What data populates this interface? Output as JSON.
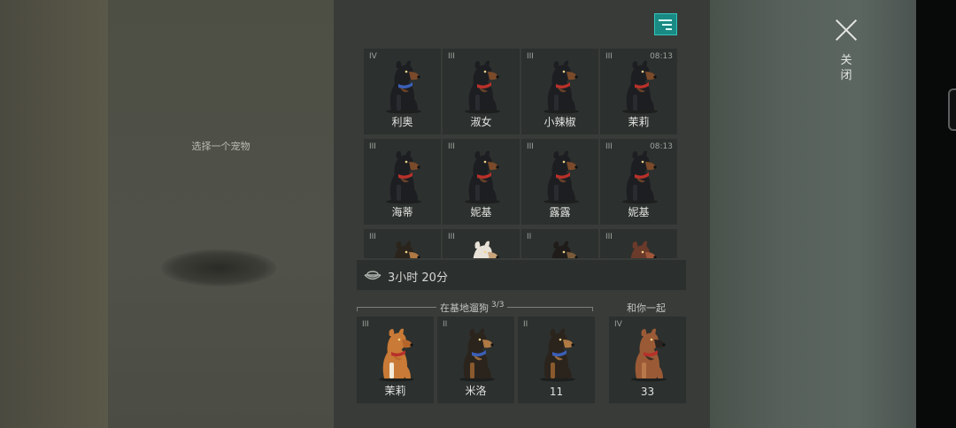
{
  "left": {
    "hint": "选择一个宠物"
  },
  "header": {
    "close_label": "关闭"
  },
  "colors": {
    "accent": "#1a8a84",
    "panel": "#383b38",
    "cell": "#2c302e"
  },
  "grid": [
    {
      "rank": "IV",
      "name": "利奥",
      "timer": "",
      "breed": "rottweiler",
      "collar": "#3a5fb8"
    },
    {
      "rank": "III",
      "name": "淑女",
      "timer": "",
      "breed": "rottweiler",
      "collar": "#b8302a"
    },
    {
      "rank": "III",
      "name": "小辣椒",
      "timer": "",
      "breed": "rottweiler",
      "collar": "#b8302a"
    },
    {
      "rank": "III",
      "name": "茉莉",
      "timer": "08:13",
      "breed": "rottweiler",
      "collar": "#b8302a"
    },
    {
      "rank": "III",
      "name": "海蒂",
      "timer": "",
      "breed": "rottweiler",
      "collar": "#b8302a"
    },
    {
      "rank": "III",
      "name": "妮基",
      "timer": "",
      "breed": "rottweiler",
      "collar": "#b8302a"
    },
    {
      "rank": "III",
      "name": "露露",
      "timer": "",
      "breed": "rottweiler",
      "collar": "#b8302a"
    },
    {
      "rank": "III",
      "name": "妮基",
      "timer": "08:13",
      "breed": "rottweiler",
      "collar": "#b8302a"
    },
    {
      "rank": "III",
      "name": "",
      "timer": "",
      "breed": "shepherd",
      "collar": "#b8302a"
    },
    {
      "rank": "III",
      "name": "",
      "timer": "",
      "breed": "akita",
      "collar": "#b8302a"
    },
    {
      "rank": "II",
      "name": "",
      "timer": "",
      "breed": "shepherd-dark",
      "collar": "#3a5fb8"
    },
    {
      "rank": "III",
      "name": "",
      "timer": "",
      "breed": "husky",
      "collar": "#b8302a"
    }
  ],
  "food": {
    "icon": "food-bowl-icon",
    "text": "3小时 20分"
  },
  "base_section": {
    "title": "在基地遛狗",
    "count": "3/3"
  },
  "with_you_section": {
    "title": "和你一起"
  },
  "base_dogs": [
    {
      "rank": "III",
      "name": "茉莉",
      "breed": "corgi",
      "collar": "#b8302a"
    },
    {
      "rank": "II",
      "name": "米洛",
      "breed": "shepherd",
      "collar": "#3a5fb8"
    },
    {
      "rank": "II",
      "name": "11",
      "breed": "shepherd",
      "collar": "#3a5fb8"
    }
  ],
  "with_you_dog": {
    "rank": "IV",
    "name": "33",
    "breed": "malinois",
    "collar": "#b8302a"
  }
}
